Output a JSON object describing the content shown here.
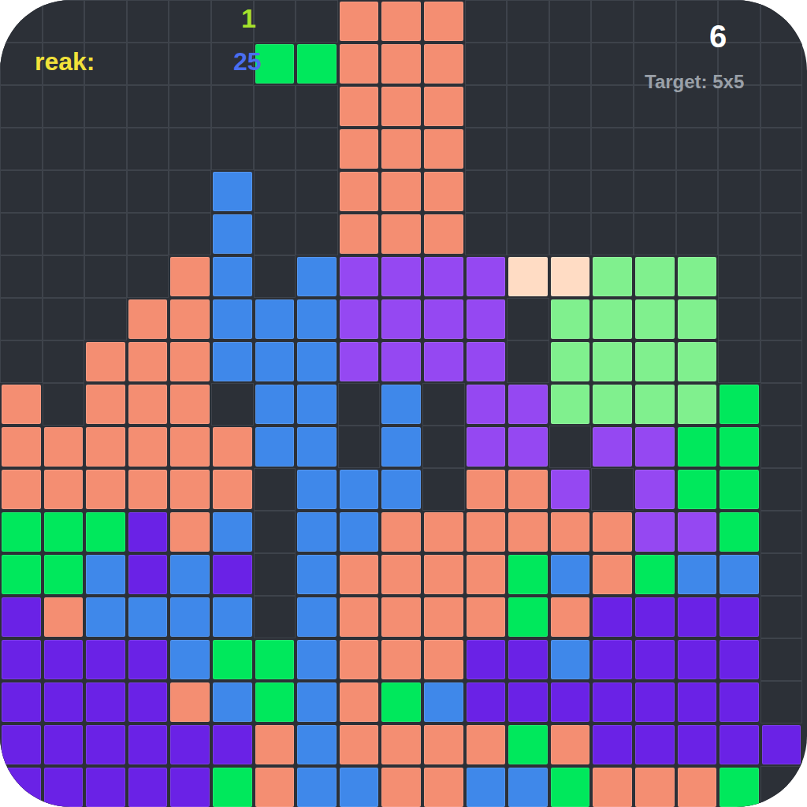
{
  "hud": {
    "level": "1",
    "streak_label": "reak:",
    "streak_value": "25",
    "score": "6",
    "target": "Target: 5x5"
  },
  "board": {
    "palette": {
      "O": "#f48e72",
      "B": "#3f88ea",
      "V": "#9548f2",
      "P": "#6a22e6",
      "G": "#00e85c",
      "L": "#80f08e",
      "C": "#ffdcc4"
    },
    "rows": [
      "........OOO........",
      "......GGOOO........",
      "........OOO........",
      "........OOO........",
      ".....B..OOO........",
      ".....B..OOO........",
      "....OB.BVVVVCCLLL..",
      "...OOBBBVVVV.LLLL..",
      "..OOOBBBVVVV.LLLL..",
      "O.OOO.BB.B.VVLLLLG.",
      "OOOOOOBB.B.VV.VVGG.",
      "OOOOOO.BBB.OOV.VGG.",
      "GGGPOB.BBOOOOOOVVG.",
      "GGBPBP.BOOOOGBOGBB.",
      "POBBBB.BOOOOGOPPPP.",
      "PPPPBGGBOOOPPBPPPP.",
      "PPPPOBGBOGBPPPPPPP.",
      "PPPPPPOBOOOOGOPPPPP",
      "PPPPPGOBBOOBBGOOOG."
    ]
  }
}
